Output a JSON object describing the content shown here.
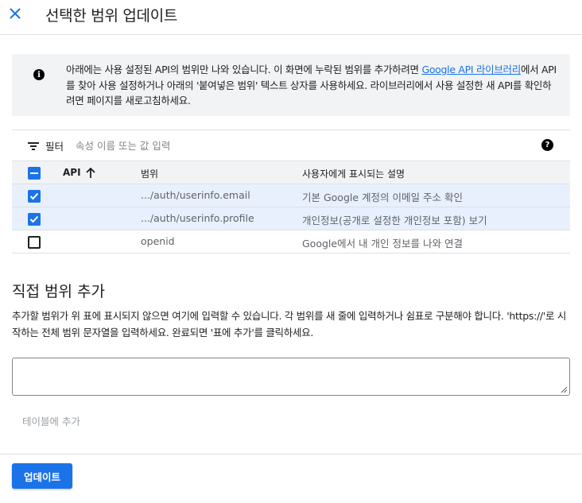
{
  "dialog": {
    "title": "선택한 범위 업데이트"
  },
  "info": {
    "text_before_link": "아래에는 사용 설정된 API의 범위만 나와 있습니다. 이 화면에 누락된 범위를 추가하려면 ",
    "link_text": "Google API 라이브러리",
    "text_after_link": "에서 API를 찾아 사용 설정하거나 아래의 '붙여넣은 범위' 텍스트 상자를 사용하세요. 라이브러리에서 사용 설정한 새 API를 확인하려면 페이지를 새로고침하세요."
  },
  "filter": {
    "label": "필터",
    "placeholder": "속성 이름 또는 값 입력"
  },
  "table": {
    "headers": {
      "api": "API",
      "scope": "범위",
      "description": "사용자에게 표시되는 설명"
    },
    "select_all_state": "indeterminate",
    "rows": [
      {
        "checked": true,
        "api": "",
        "scope": ".../auth/userinfo.email",
        "description": "기본 Google 계정의 이메일 주소 확인"
      },
      {
        "checked": true,
        "api": "",
        "scope": ".../auth/userinfo.profile",
        "description": "개인정보(공개로 설정한 개인정보 포함) 보기"
      },
      {
        "checked": false,
        "api": "",
        "scope": "openid",
        "description": "Google에서 내 개인 정보를 나와 연결"
      }
    ]
  },
  "manual": {
    "title": "직접 범위 추가",
    "description": "추가할 범위가 위 표에 표시되지 않으면 여기에 입력할 수 있습니다. 각 범위를 새 줄에 입력하거나 쉼표로 구분해야 합니다. 'https://'로 시작하는 전체 범위 문자열을 입력하세요. 완료되면 '표에 추가'를 클릭하세요.",
    "textarea_value": "",
    "add_button": "테이블에 추가"
  },
  "footer": {
    "update_button": "업데이트"
  },
  "colors": {
    "accent": "#1a73e8",
    "selected_row": "#e8f0fe",
    "info_bg": "#f1f3f4"
  }
}
